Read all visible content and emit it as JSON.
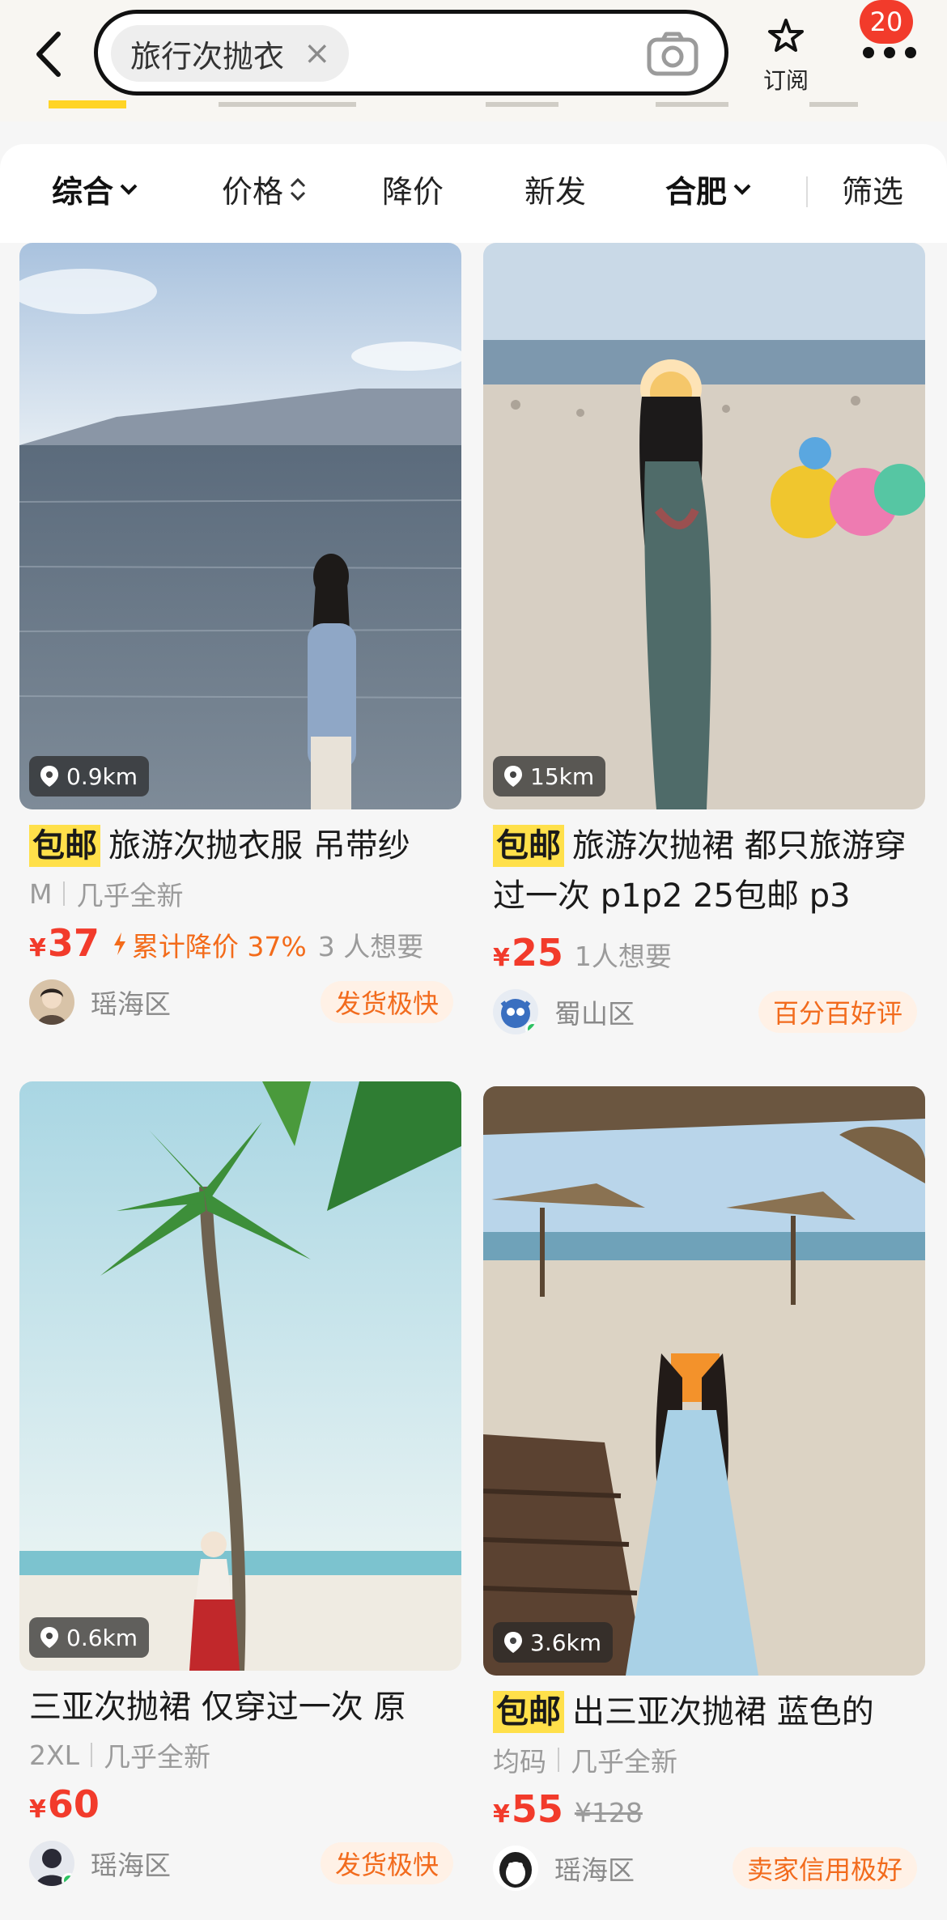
{
  "header": {
    "search_query": "旅行次抛衣",
    "subscribe_label": "订阅",
    "notification_count": "20"
  },
  "filters": [
    {
      "label": "综合"
    },
    {
      "label": "价格"
    },
    {
      "label": "降价"
    },
    {
      "label": "新发"
    },
    {
      "label": "合肥"
    },
    {
      "label": "筛选"
    }
  ],
  "products": [
    {
      "distance": "0.9km",
      "tag": "包邮",
      "title": "旅游次抛衣服 吊带纱",
      "size": "M",
      "condition": "几乎全新",
      "currency": "¥",
      "price": "37",
      "price_drop": "累计降价 37%",
      "wants": "3 人想要",
      "area": "瑶海区",
      "badge": "发货极快"
    },
    {
      "distance": "15km",
      "tag": "包邮",
      "title": "旅游次抛裙 都只旅游穿过一次 p1p2 25包邮 p3",
      "currency": "¥",
      "price": "25",
      "wants": "1人想要",
      "area": "蜀山区",
      "badge": "百分百好评"
    },
    {
      "distance": "0.6km",
      "title": "三亚次抛裙 仅穿过一次 原",
      "size": "2XL",
      "condition": "几乎全新",
      "currency": "¥",
      "price": "60",
      "area": "瑶海区",
      "badge": "发货极快"
    },
    {
      "distance": "3.6km",
      "tag": "包邮",
      "title": "出三亚次抛裙 蓝色的",
      "size": "均码",
      "condition": "几乎全新",
      "currency": "¥",
      "price": "55",
      "original_price": "¥128",
      "area": "瑶海区",
      "badge": "卖家信用极好"
    }
  ],
  "colors": {
    "price": "#f23b2b",
    "tag_bg": "#ffe04a",
    "badge_text": "#f26b1d",
    "badge_bg": "#fff1e6",
    "notification": "#f23b2b"
  }
}
